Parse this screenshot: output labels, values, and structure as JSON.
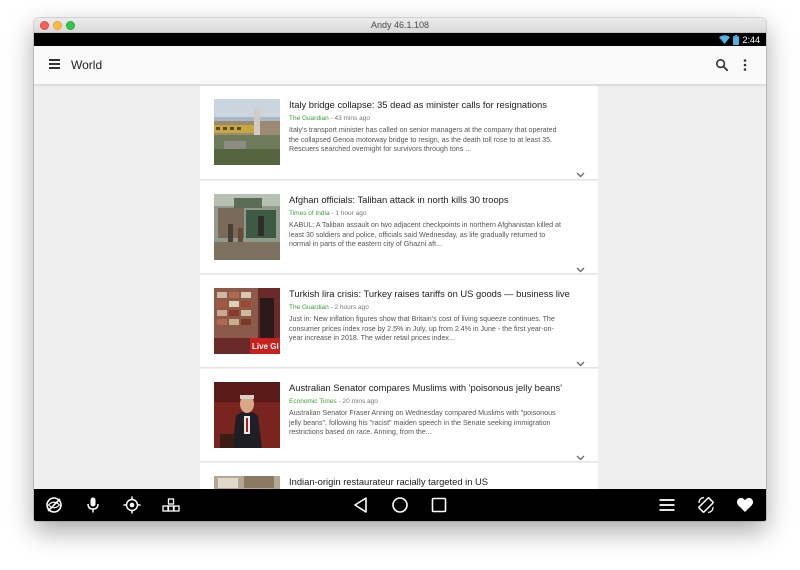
{
  "window": {
    "title": "Andy 46.1.108"
  },
  "status_bar": {
    "time": "2:44",
    "icons": [
      "wifi-icon",
      "battery-icon"
    ]
  },
  "app_bar": {
    "title": "World",
    "icons": [
      "menu-icon",
      "search-icon",
      "more-vert-icon"
    ]
  },
  "colors": {
    "source_green": "#3d9b3d",
    "nav_bar": "#000000",
    "background": "#efefef"
  },
  "articles": [
    {
      "title": "Italy bridge collapse: 35 dead as minister calls for resignations",
      "source": "The Guardian",
      "time": " - 43 mins ago",
      "snippet": "Italy's transport minister has called on senior managers at the company that operated the collapsed Genoa motorway bridge to resign, as the death toll rose to at least 35. Rescuers searched overnight for survivors through tons ..."
    },
    {
      "title": "Afghan officials: Taliban attack in north kills 30 troops",
      "source": "Times of India",
      "time": " - 1 hour ago",
      "snippet": "KABUL: A Taliban assault on two adjacent checkpoints in northern Afghanistan killed at least 30 soldiers and police, officials said Wednesday, as life gradually returned to normal in parts of the eastern city of Ghazni aft..."
    },
    {
      "title": "Turkish lira crisis: Turkey raises tariffs on US goods — business live",
      "source": "The Guardian",
      "time": " - 2 hours ago",
      "snippet": "Just in: New inflation figures show that Britain's cost of living squeeze continues. The consumer prices index rose by 2.5% in July, up from 2.4% in June - the first year-on-year increase in 2018. The wider retail prices index..."
    },
    {
      "title": "Australian Senator compares Muslims with 'poisonous jelly beans'",
      "source": "Economic Times",
      "time": " - 20 mins ago",
      "snippet": "Australian Senator Fraser Anning on Wednesday compared Muslims with \"poisonous jelly beans\", following his \"racist\" maiden speech in the Senate seeking immigration restrictions based on race. Anning, from the..."
    },
    {
      "title": "Indian-origin restaurateur racially targeted in US",
      "source": "",
      "time": "",
      "snippet": ""
    }
  ],
  "thumb_overlays": {
    "live_label": "Live Gl"
  },
  "nav_bar": {
    "left_icons": [
      "hide-icon",
      "microphone-icon",
      "gps-icon",
      "blocks-icon"
    ],
    "center_icons": [
      "back-icon",
      "home-icon",
      "recents-icon"
    ],
    "right_icons": [
      "menu-icon",
      "rotate-icon",
      "heart-icon"
    ]
  }
}
